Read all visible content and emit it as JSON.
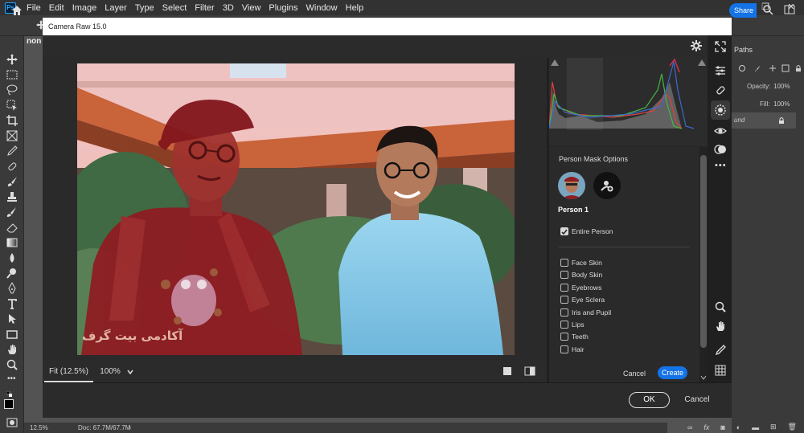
{
  "menubar": {
    "items": [
      "File",
      "Edit",
      "Image",
      "Layer",
      "Type",
      "Select",
      "Filter",
      "3D",
      "View",
      "Plugins",
      "Window",
      "Help"
    ],
    "window_controls": [
      "—",
      "❐",
      "✕"
    ]
  },
  "optionsbar": {
    "share_label": "Share"
  },
  "document": {
    "tab_label": "non",
    "zoom": "12.5%",
    "doc_info": "Doc: 67.7M/67.7M"
  },
  "ps_panels": {
    "paths_tab": "Paths",
    "opacity_label": "Opacity:",
    "opacity_value": "100%",
    "fill_label": "Fill:",
    "fill_value": "100%",
    "layer_name": "und"
  },
  "camera_raw": {
    "title": "Camera Raw 15.0",
    "zoom_fit": "Fit (12.5%)",
    "zoom_100": "100%",
    "ok_label": "OK",
    "cancel_label": "Cancel",
    "watermark": "آکادمی بیت گرف",
    "mask_panel": {
      "title": "Person Mask Options",
      "person_label": "Person 1",
      "entire_person": {
        "label": "Entire Person",
        "checked": true
      },
      "parts": [
        {
          "label": "Face Skin",
          "checked": false
        },
        {
          "label": "Body Skin",
          "checked": false
        },
        {
          "label": "Eyebrows",
          "checked": false
        },
        {
          "label": "Eye Sclera",
          "checked": false
        },
        {
          "label": "Iris and Pupil",
          "checked": false
        },
        {
          "label": "Lips",
          "checked": false
        },
        {
          "label": "Teeth",
          "checked": false
        },
        {
          "label": "Hair",
          "checked": false
        }
      ],
      "cancel_label": "Cancel",
      "create_label": "Create"
    }
  },
  "colors": {
    "accent": "#1473e6",
    "mask_overlay": "#b4141e"
  }
}
